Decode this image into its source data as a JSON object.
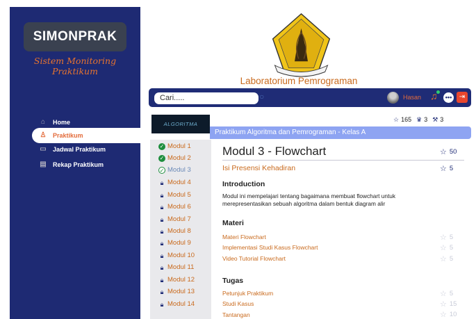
{
  "app": {
    "brand": "SIMONPRAK",
    "tagline": "Sistem Monitoring Praktikum"
  },
  "sidebar": {
    "items": [
      {
        "label": "Home",
        "icon": "home-icon"
      },
      {
        "label": "Praktikum",
        "icon": "user-icon",
        "active": true
      },
      {
        "label": "Jadwal Praktikum",
        "icon": "calendar-icon"
      },
      {
        "label": "Rekap Praktikum",
        "icon": "report-icon"
      }
    ]
  },
  "header": {
    "lab_title": "Laboratorium Pemrograman",
    "logo": "university-seal"
  },
  "topbar": {
    "search_value": "Cari.....",
    "search_icon": "search-icon",
    "user_name": "Hasan",
    "icons": [
      "bell-icon",
      "chat-icon",
      "logout-icon"
    ]
  },
  "course": {
    "thumbnail_text": "ALGORITMA",
    "title": "Praktikum Algoritma dan Pemrograman - Kelas A",
    "stats": {
      "stars": "165",
      "trophies": "3",
      "tools": "3"
    }
  },
  "modules": [
    {
      "label": "Modul 1",
      "status": "done"
    },
    {
      "label": "Modul 2",
      "status": "done"
    },
    {
      "label": "Modul 3",
      "status": "current"
    },
    {
      "label": "Modul 4",
      "status": "locked"
    },
    {
      "label": "Modul 5",
      "status": "locked"
    },
    {
      "label": "Modul 6",
      "status": "locked"
    },
    {
      "label": "Modul 7",
      "status": "locked"
    },
    {
      "label": "Modul 8",
      "status": "locked"
    },
    {
      "label": "Modul 9",
      "status": "locked"
    },
    {
      "label": "Modul 10",
      "status": "locked"
    },
    {
      "label": "Modul 11",
      "status": "locked"
    },
    {
      "label": "Modul 12",
      "status": "locked"
    },
    {
      "label": "Modul 13",
      "status": "locked"
    },
    {
      "label": "Modul 14",
      "status": "locked"
    }
  ],
  "content": {
    "module_title": "Modul 3 - Flowchart",
    "module_stars": "50",
    "attendance_label": "Isi Presensi Kehadiran",
    "attendance_stars": "5",
    "intro_heading": "Introduction",
    "intro_text": "Modul ini mempelajari tentang bagaimana membuat flowchart untuk merepresentasikan sebuah algoritma dalam bentuk diagram alir",
    "materi_heading": "Materi",
    "materi": [
      {
        "label": "Materi Flowchart",
        "stars": "5"
      },
      {
        "label": "Implementasi Studi Kasus Flowchart",
        "stars": "5"
      },
      {
        "label": "Video Tutorial Flowchart",
        "stars": "5"
      }
    ],
    "tugas_heading": "Tugas",
    "tugas": [
      {
        "label": "Petunjuk Praktikum",
        "stars": "5"
      },
      {
        "label": "Studi Kasus",
        "stars": "15"
      },
      {
        "label": "Tantangan",
        "stars": "10"
      }
    ]
  },
  "colors": {
    "primary": "#1f2c76",
    "accent": "#e8742e",
    "success": "#1e8e3e",
    "banner": "#8ea4f2"
  }
}
